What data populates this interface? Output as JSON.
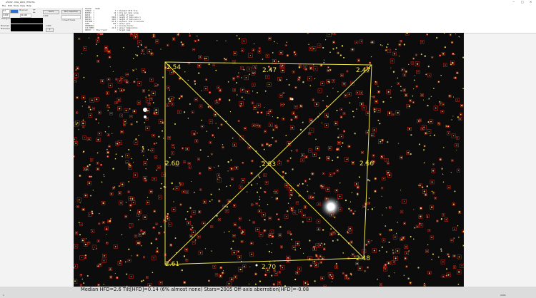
{
  "window": {
    "title": "ASTAP - IMG_0001_HFD.fits",
    "controls": [
      "−",
      "□",
      "×"
    ]
  },
  "menu": [
    "File",
    "Edit",
    "Tools",
    "View",
    "Help"
  ],
  "toolbar": {
    "zoom_value": "0.7",
    "field_value": "20.000",
    "hist_label": "Histogram",
    "min_label": "Minimum",
    "max_label": "Maximum",
    "stretch_value": "1.000",
    "gamma_value": "1.000",
    "solve_button": "Solve",
    "inspect_button": "Run inspection",
    "checkbox_label": "Flip H",
    "checkbox2_label": "Invert Y-axis"
  },
  "memo": {
    "tabs": [
      "Header",
      "Stats"
    ],
    "lines": [
      "SIMPLE  =                    T / Standard FITS file",
      "BITPIX  =                   16 / bits per data value",
      "NAXIS   =                    2 / number of axes",
      "NAXIS1  =                 6024 / length of data axis 1",
      "NAXIS2  =                 4024 / length of data axis 2",
      "EXPTIME =                 60.0 / exposure time in seconds",
      "GAIN    =                  100 / sensor gain",
      "XBINNING=                    1 / binning factor",
      "CCD-TEMP=                -10.0 / sensor temperature",
      "OBJECT  = 'Star field'         / target name",
      "HFD     =                  2.6 / median half flux diameter"
    ]
  },
  "inspection": {
    "corner_labels": {
      "top_left": "2.54",
      "top_mid": "2.47",
      "top_right": "2.47",
      "mid_left": "2.60",
      "center": "2.53",
      "mid_right": "2.56",
      "bottom_left": "2.61",
      "bottom_mid": "2.70",
      "bottom_right": "2.48"
    },
    "overlay_color": "#f2e84a",
    "marker_color": "#d81e1e"
  },
  "status": {
    "summary": "Median HFD=2.6  Tilt[HFD]=0.14 (6% almost none)  Stars=2005  Off-axis aberration[HFD]=-0.08",
    "sub_left": "1",
    "sub_right": "2005"
  }
}
